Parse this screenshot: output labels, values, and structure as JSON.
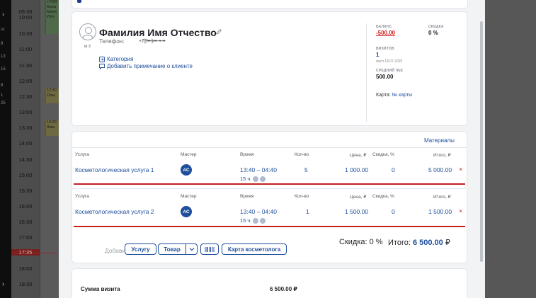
{
  "calendar": {
    "times": [
      "09:30",
      "10:00",
      "10:30",
      "11:00",
      "11:30",
      "12:00",
      "12:30",
      "13:00",
      "13:30",
      "14:00",
      "14:30",
      "15:00",
      "15:30",
      "16:00",
      "16:30",
      "17:00",
      "17:30",
      "17:35",
      "18:00",
      "18:30"
    ],
    "now_time": "17:35",
    "appointments": [
      {
        "lines": [
          "+7(99",
          "Бала",
          "Мани",
          "Итог"
        ]
      },
      {
        "lines": [
          "12:30",
          "Ольг"
        ]
      },
      {
        "lines": [
          "13:30",
          "Фам"
        ]
      }
    ],
    "rail_numbers": [
      "зс",
      "9",
      "13",
      "15",
      "8",
      "1",
      "25"
    ]
  },
  "client": {
    "name": "Фамилия Имя Отчество",
    "id_label": "id 3",
    "phone_label": "Телефон:",
    "phone_value": "+7(9•••)•••-••-••",
    "category_link": "Категория",
    "note_link": "Добавить примечание о клиенте",
    "stats": {
      "balance_label": "БАЛАНС",
      "balance_value": "-500.00",
      "discount_label": "СКИДКА",
      "discount_value": "0 %",
      "visits_label": "ВИЗИТОВ",
      "visits_value": "1",
      "last_visit": "посл 18.07.2025",
      "avg_check_label": "СРЕДНИЙ ЧЕК",
      "avg_check_value": "500.00",
      "card_label": "Карта:",
      "card_link": "№ карты"
    }
  },
  "services": {
    "materials_link": "Материалы",
    "headers": {
      "service": "Услуга",
      "master": "Мастер",
      "time": "Время",
      "qty": "Кол-во",
      "price": "Цена, ₽",
      "discount": "Скидка, %",
      "total": "Итого, ₽"
    },
    "rows": [
      {
        "service": "Косметологическая услуга 1",
        "master": "АС",
        "time": "13:40 – 04:40",
        "duration": "15 ч.",
        "qty": "5",
        "price": "1 000.00",
        "discount": "0",
        "total": "5 000.00"
      },
      {
        "service": "Косметологическая услуга 2",
        "master": "АС",
        "time": "13:40 – 04:40",
        "duration": "15 ч.",
        "qty": "1",
        "price": "1 500.00",
        "discount": "0",
        "total": "1 500.00"
      }
    ],
    "add_label": "Добавить",
    "buttons": {
      "service": "Услугу",
      "product": "Товар",
      "cosmetologist_card": "Карта косметолога"
    },
    "discount_summary_label": "Скидка:",
    "discount_summary_value": "0 %",
    "total_label": "Итого:",
    "total_value": "6 500.00",
    "currency": "₽"
  },
  "summary": {
    "visit_sum_label": "Сумма визита",
    "visit_sum_value": "6 500.00 ₽"
  },
  "colors": {
    "accent": "#1e4e9c",
    "danger": "#d32020"
  }
}
